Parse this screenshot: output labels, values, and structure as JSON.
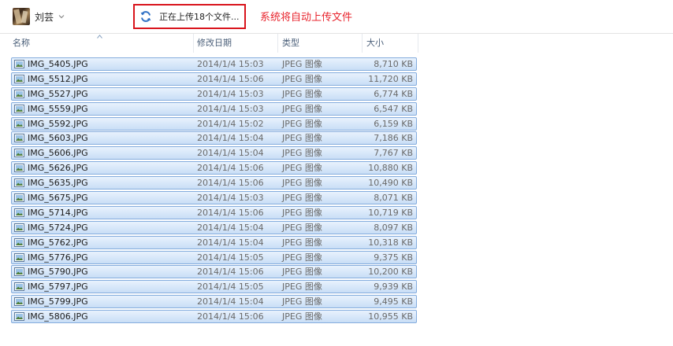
{
  "user": {
    "name": "刘芸"
  },
  "upload_status": {
    "label": "正在上传18个文件..."
  },
  "annotation": "系统将自动上传文件",
  "columns": {
    "name": "名称",
    "date": "修改日期",
    "type": "类型",
    "size": "大小"
  },
  "files": [
    {
      "name": "IMG_5405.JPG",
      "date": "2014/1/4 15:03",
      "type": "JPEG 图像",
      "size": "8,710 KB"
    },
    {
      "name": "IMG_5512.JPG",
      "date": "2014/1/4 15:06",
      "type": "JPEG 图像",
      "size": "11,720 KB"
    },
    {
      "name": "IMG_5527.JPG",
      "date": "2014/1/4 15:03",
      "type": "JPEG 图像",
      "size": "6,774 KB"
    },
    {
      "name": "IMG_5559.JPG",
      "date": "2014/1/4 15:03",
      "type": "JPEG 图像",
      "size": "6,547 KB"
    },
    {
      "name": "IMG_5592.JPG",
      "date": "2014/1/4 15:02",
      "type": "JPEG 图像",
      "size": "6,159 KB"
    },
    {
      "name": "IMG_5603.JPG",
      "date": "2014/1/4 15:04",
      "type": "JPEG 图像",
      "size": "7,186 KB"
    },
    {
      "name": "IMG_5606.JPG",
      "date": "2014/1/4 15:04",
      "type": "JPEG 图像",
      "size": "7,767 KB"
    },
    {
      "name": "IMG_5626.JPG",
      "date": "2014/1/4 15:06",
      "type": "JPEG 图像",
      "size": "10,880 KB"
    },
    {
      "name": "IMG_5635.JPG",
      "date": "2014/1/4 15:06",
      "type": "JPEG 图像",
      "size": "10,490 KB"
    },
    {
      "name": "IMG_5675.JPG",
      "date": "2014/1/4 15:03",
      "type": "JPEG 图像",
      "size": "8,071 KB"
    },
    {
      "name": "IMG_5714.JPG",
      "date": "2014/1/4 15:06",
      "type": "JPEG 图像",
      "size": "10,719 KB"
    },
    {
      "name": "IMG_5724.JPG",
      "date": "2014/1/4 15:04",
      "type": "JPEG 图像",
      "size": "8,097 KB"
    },
    {
      "name": "IMG_5762.JPG",
      "date": "2014/1/4 15:04",
      "type": "JPEG 图像",
      "size": "10,318 KB"
    },
    {
      "name": "IMG_5776.JPG",
      "date": "2014/1/4 15:05",
      "type": "JPEG 图像",
      "size": "9,375 KB"
    },
    {
      "name": "IMG_5790.JPG",
      "date": "2014/1/4 15:06",
      "type": "JPEG 图像",
      "size": "10,200 KB"
    },
    {
      "name": "IMG_5797.JPG",
      "date": "2014/1/4 15:05",
      "type": "JPEG 图像",
      "size": "9,939 KB"
    },
    {
      "name": "IMG_5799.JPG",
      "date": "2014/1/4 15:04",
      "type": "JPEG 图像",
      "size": "9,495 KB"
    },
    {
      "name": "IMG_5806.JPG",
      "date": "2014/1/4 15:06",
      "type": "JPEG 图像",
      "size": "10,955 KB"
    }
  ],
  "colors": {
    "accent_red": "#d9141c",
    "annotation_red": "#e8252e",
    "selection_border": "#84acdd",
    "selection_fill": "#c9def6",
    "header_text": "#4c607a"
  },
  "icons": {
    "sync": "sync-icon",
    "file": "image-file-icon",
    "chevron": "chevron-down-icon",
    "sort": "sort-ascending-icon"
  }
}
